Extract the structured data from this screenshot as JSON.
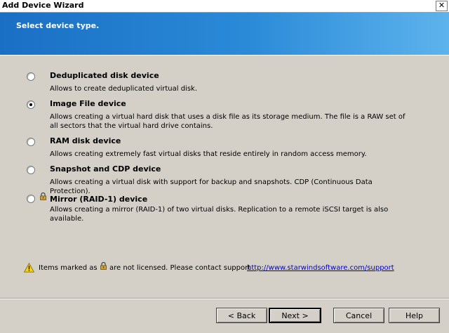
{
  "window": {
    "title": "Add Device Wizard",
    "close_label": "✕"
  },
  "header": {
    "subtitle": "Select device type."
  },
  "options": [
    {
      "title": "Deduplicated disk device",
      "description": "Allows to create deduplicated virtual disk.",
      "selected": false,
      "locked": false
    },
    {
      "title": "Image File device",
      "description": "Allows creating a virtual hard disk that uses a disk file as its storage medium. The file is a RAW set of all sectors that the virtual hard drive contains.",
      "selected": true,
      "locked": false
    },
    {
      "title": "RAM disk device",
      "description": "Allows creating extremely fast virtual disks that reside entirely in random access memory.",
      "selected": false,
      "locked": false
    },
    {
      "title": "Snapshot and CDP device",
      "description": "Allows creating a virtual disk with support for backup and snapshots. CDP (Continuous Data Protection).",
      "selected": false,
      "locked": false
    },
    {
      "title": "Mirror (RAID-1) device",
      "description": "Allows creating a mirror (RAID-1) of two virtual disks. Replication to a remote iSCSI target is also available.",
      "selected": false,
      "locked": true
    }
  ],
  "footer_note": {
    "text_before": "Items marked as",
    "text_after": "are not licensed. Please contact support",
    "link_text": "http://www.starwindsoftware.com/support"
  },
  "buttons": {
    "back": "< Back",
    "next": "Next >",
    "cancel": "Cancel",
    "help": "Help"
  },
  "colors": {
    "header_start": "#1a6fc4",
    "header_end": "#5db3ec",
    "link": "#0000cc"
  }
}
